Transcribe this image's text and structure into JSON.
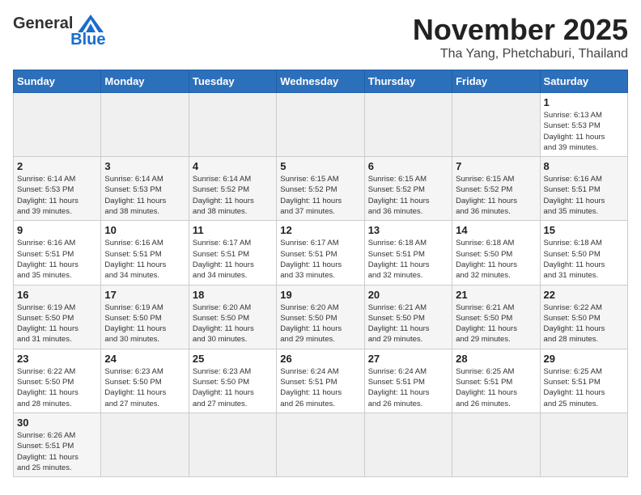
{
  "header": {
    "logo_line1": "General",
    "logo_line2": "Blue",
    "month_title": "November 2025",
    "location": "Tha Yang, Phetchaburi, Thailand"
  },
  "weekdays": [
    "Sunday",
    "Monday",
    "Tuesday",
    "Wednesday",
    "Thursday",
    "Friday",
    "Saturday"
  ],
  "weeks": [
    [
      {
        "day": "",
        "info": ""
      },
      {
        "day": "",
        "info": ""
      },
      {
        "day": "",
        "info": ""
      },
      {
        "day": "",
        "info": ""
      },
      {
        "day": "",
        "info": ""
      },
      {
        "day": "",
        "info": ""
      },
      {
        "day": "1",
        "info": "Sunrise: 6:13 AM\nSunset: 5:53 PM\nDaylight: 11 hours\nand 39 minutes."
      }
    ],
    [
      {
        "day": "2",
        "info": "Sunrise: 6:14 AM\nSunset: 5:53 PM\nDaylight: 11 hours\nand 39 minutes."
      },
      {
        "day": "3",
        "info": "Sunrise: 6:14 AM\nSunset: 5:53 PM\nDaylight: 11 hours\nand 38 minutes."
      },
      {
        "day": "4",
        "info": "Sunrise: 6:14 AM\nSunset: 5:52 PM\nDaylight: 11 hours\nand 38 minutes."
      },
      {
        "day": "5",
        "info": "Sunrise: 6:15 AM\nSunset: 5:52 PM\nDaylight: 11 hours\nand 37 minutes."
      },
      {
        "day": "6",
        "info": "Sunrise: 6:15 AM\nSunset: 5:52 PM\nDaylight: 11 hours\nand 36 minutes."
      },
      {
        "day": "7",
        "info": "Sunrise: 6:15 AM\nSunset: 5:52 PM\nDaylight: 11 hours\nand 36 minutes."
      },
      {
        "day": "8",
        "info": "Sunrise: 6:16 AM\nSunset: 5:51 PM\nDaylight: 11 hours\nand 35 minutes."
      }
    ],
    [
      {
        "day": "9",
        "info": "Sunrise: 6:16 AM\nSunset: 5:51 PM\nDaylight: 11 hours\nand 35 minutes."
      },
      {
        "day": "10",
        "info": "Sunrise: 6:16 AM\nSunset: 5:51 PM\nDaylight: 11 hours\nand 34 minutes."
      },
      {
        "day": "11",
        "info": "Sunrise: 6:17 AM\nSunset: 5:51 PM\nDaylight: 11 hours\nand 34 minutes."
      },
      {
        "day": "12",
        "info": "Sunrise: 6:17 AM\nSunset: 5:51 PM\nDaylight: 11 hours\nand 33 minutes."
      },
      {
        "day": "13",
        "info": "Sunrise: 6:18 AM\nSunset: 5:51 PM\nDaylight: 11 hours\nand 32 minutes."
      },
      {
        "day": "14",
        "info": "Sunrise: 6:18 AM\nSunset: 5:50 PM\nDaylight: 11 hours\nand 32 minutes."
      },
      {
        "day": "15",
        "info": "Sunrise: 6:18 AM\nSunset: 5:50 PM\nDaylight: 11 hours\nand 31 minutes."
      }
    ],
    [
      {
        "day": "16",
        "info": "Sunrise: 6:19 AM\nSunset: 5:50 PM\nDaylight: 11 hours\nand 31 minutes."
      },
      {
        "day": "17",
        "info": "Sunrise: 6:19 AM\nSunset: 5:50 PM\nDaylight: 11 hours\nand 30 minutes."
      },
      {
        "day": "18",
        "info": "Sunrise: 6:20 AM\nSunset: 5:50 PM\nDaylight: 11 hours\nand 30 minutes."
      },
      {
        "day": "19",
        "info": "Sunrise: 6:20 AM\nSunset: 5:50 PM\nDaylight: 11 hours\nand 29 minutes."
      },
      {
        "day": "20",
        "info": "Sunrise: 6:21 AM\nSunset: 5:50 PM\nDaylight: 11 hours\nand 29 minutes."
      },
      {
        "day": "21",
        "info": "Sunrise: 6:21 AM\nSunset: 5:50 PM\nDaylight: 11 hours\nand 29 minutes."
      },
      {
        "day": "22",
        "info": "Sunrise: 6:22 AM\nSunset: 5:50 PM\nDaylight: 11 hours\nand 28 minutes."
      }
    ],
    [
      {
        "day": "23",
        "info": "Sunrise: 6:22 AM\nSunset: 5:50 PM\nDaylight: 11 hours\nand 28 minutes."
      },
      {
        "day": "24",
        "info": "Sunrise: 6:23 AM\nSunset: 5:50 PM\nDaylight: 11 hours\nand 27 minutes."
      },
      {
        "day": "25",
        "info": "Sunrise: 6:23 AM\nSunset: 5:50 PM\nDaylight: 11 hours\nand 27 minutes."
      },
      {
        "day": "26",
        "info": "Sunrise: 6:24 AM\nSunset: 5:51 PM\nDaylight: 11 hours\nand 26 minutes."
      },
      {
        "day": "27",
        "info": "Sunrise: 6:24 AM\nSunset: 5:51 PM\nDaylight: 11 hours\nand 26 minutes."
      },
      {
        "day": "28",
        "info": "Sunrise: 6:25 AM\nSunset: 5:51 PM\nDaylight: 11 hours\nand 26 minutes."
      },
      {
        "day": "29",
        "info": "Sunrise: 6:25 AM\nSunset: 5:51 PM\nDaylight: 11 hours\nand 25 minutes."
      }
    ],
    [
      {
        "day": "30",
        "info": "Sunrise: 6:26 AM\nSunset: 5:51 PM\nDaylight: 11 hours\nand 25 minutes."
      },
      {
        "day": "",
        "info": ""
      },
      {
        "day": "",
        "info": ""
      },
      {
        "day": "",
        "info": ""
      },
      {
        "day": "",
        "info": ""
      },
      {
        "day": "",
        "info": ""
      },
      {
        "day": "",
        "info": ""
      }
    ]
  ]
}
